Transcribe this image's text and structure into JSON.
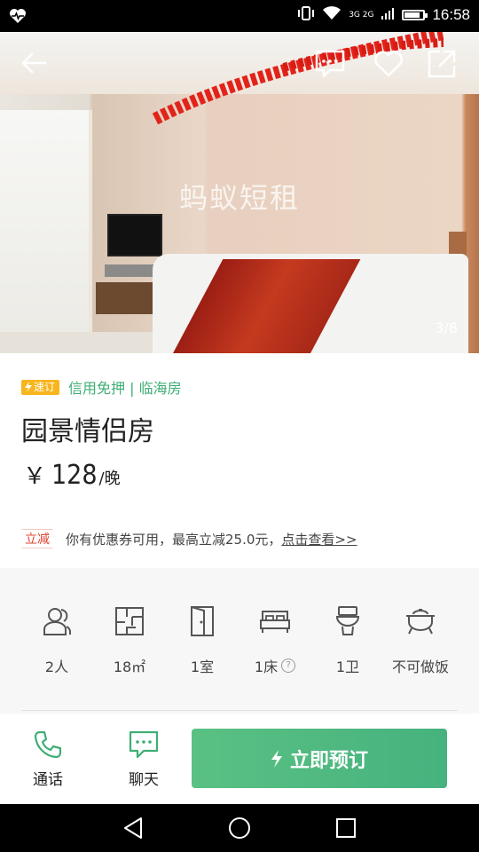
{
  "status_bar": {
    "time": "16:58",
    "network": "3G 2G"
  },
  "gallery": {
    "watermark": "蚂蚁短租",
    "counter": "3/8"
  },
  "tags": {
    "badge": "速订",
    "features": "信用免押 | 临海房"
  },
  "listing": {
    "title": "园景情侣房",
    "currency": "￥",
    "price": "128",
    "price_unit": "/晚"
  },
  "coupon": {
    "tag": "立减",
    "text": "你有优惠券可用，最高立减25.0元，",
    "link": "点击查看>>"
  },
  "amenities": [
    {
      "icon": "guests-icon",
      "label": "2人"
    },
    {
      "icon": "floor-plan-icon",
      "label": "18㎡"
    },
    {
      "icon": "door-icon",
      "label": "1室"
    },
    {
      "icon": "bed-icon",
      "label": "1床"
    },
    {
      "icon": "toilet-icon",
      "label": "1卫"
    },
    {
      "icon": "cooking-pot-icon",
      "label": "不可做饭"
    }
  ],
  "actions": {
    "call": "通话",
    "chat": "聊天",
    "book": "立即预订"
  },
  "colors": {
    "accent_green": "#4cb87e",
    "badge_yellow": "#f7b51e",
    "coupon_red": "#e0432f"
  }
}
